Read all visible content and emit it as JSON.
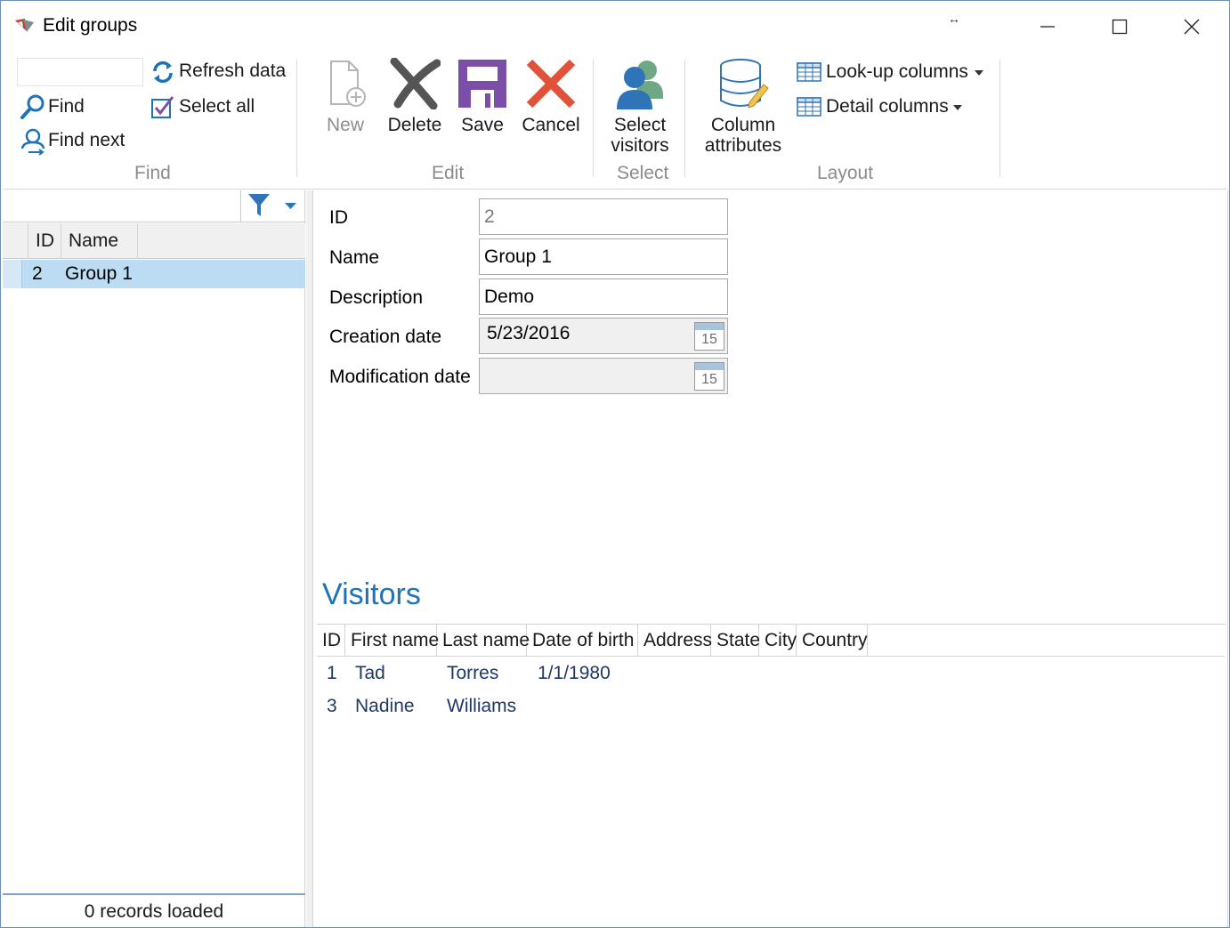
{
  "window": {
    "title": "Edit groups"
  },
  "ribbon": {
    "find_group": {
      "search_value": "",
      "refresh_label": "Refresh data",
      "find_label": "Find",
      "select_all_label": "Select all",
      "find_next_label": "Find next",
      "group_label": "Find"
    },
    "edit_group": {
      "new_label": "New",
      "delete_label": "Delete",
      "save_label": "Save",
      "cancel_label": "Cancel",
      "group_label": "Edit"
    },
    "select_group": {
      "select_visitors_line1": "Select",
      "select_visitors_line2": "visitors",
      "group_label": "Select"
    },
    "layout_group": {
      "column_attributes_line1": "Column",
      "column_attributes_line2": "attributes",
      "lookup_columns_label": "Look-up columns",
      "detail_columns_label": "Detail columns",
      "group_label": "Layout"
    }
  },
  "list": {
    "columns": [
      "ID",
      "Name"
    ],
    "rows": [
      {
        "id": "2",
        "name": "Group 1"
      }
    ],
    "status": "0 records loaded"
  },
  "form": {
    "id_label": "ID",
    "id_value": "2",
    "name_label": "Name",
    "name_value": "Group 1",
    "description_label": "Description",
    "description_value": "Demo",
    "creation_date_label": "Creation date",
    "creation_date_value": "5/23/2016",
    "modification_date_label": "Modification date",
    "modification_date_value": "",
    "calendar_day": "15"
  },
  "visitors": {
    "title": "Visitors",
    "columns": [
      "ID",
      "First name",
      "Last name",
      "Date of birth",
      "Address",
      "State",
      "City",
      "Country"
    ],
    "rows": [
      {
        "id": "1",
        "first_name": "Tad",
        "last_name": "Torres",
        "dob": "1/1/1980"
      },
      {
        "id": "3",
        "first_name": "Nadine",
        "last_name": "Williams",
        "dob": ""
      }
    ]
  },
  "colors": {
    "accent_blue": "#1e73b8",
    "selection": "#bcdcf4",
    "delete_gray": "#555555",
    "save_purple": "#7b4fa8",
    "cancel_red": "#e0533a",
    "visitor_text": "#1f3864"
  },
  "icons": {
    "app": "app-logo-icon",
    "refresh": "refresh-icon",
    "find": "search-icon",
    "select_all": "checkbox-icon",
    "find_next": "find-next-icon",
    "new": "new-document-icon",
    "delete": "delete-x-icon",
    "save": "floppy-disk-icon",
    "cancel": "cancel-x-icon",
    "select_visitors": "users-icon",
    "column_attributes": "database-edit-icon",
    "lookup_columns": "table-icon",
    "detail_columns": "table-icon",
    "filter": "filter-icon",
    "calendar": "calendar-icon"
  }
}
